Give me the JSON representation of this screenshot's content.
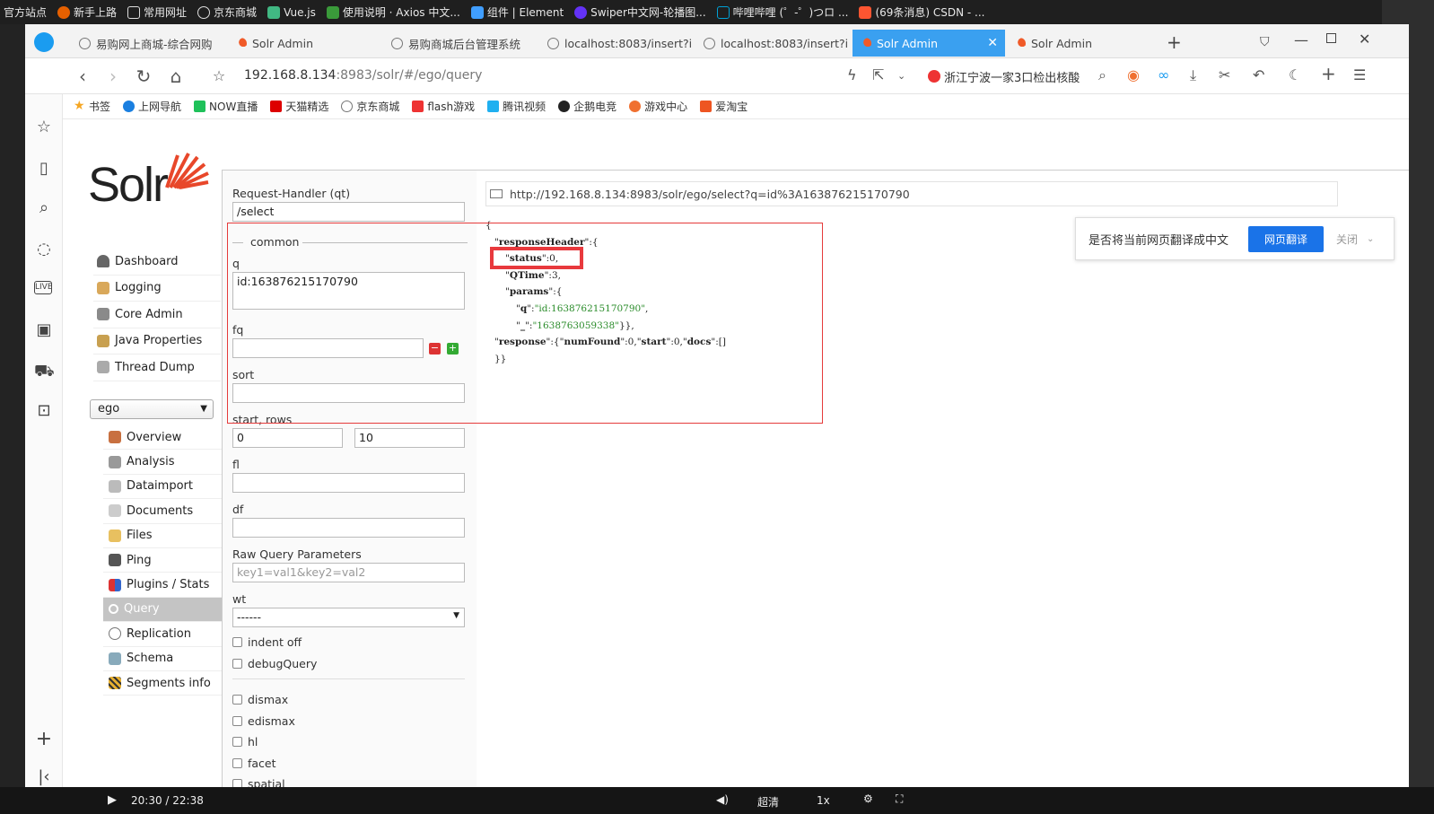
{
  "os_bookmarks": [
    "官方站点",
    "新手上路",
    "常用网址",
    "京东商城",
    "Vue.js",
    "使用说明 · Axios 中文...",
    "组件 | Element",
    "Swiper中文网-轮播图...",
    "哔哩哔哩 (゜-゜)つロ ...",
    "(69条消息) CSDN - ..."
  ],
  "tabs": [
    "易购网上商城-综合网购",
    "Solr Admin",
    "易购商城后台管理系统",
    "localhost:8083/insert?i",
    "localhost:8083/insert?i",
    "Solr Admin",
    "Solr Admin"
  ],
  "address": {
    "url_host": "192.168.8.134",
    "url_rest": ":8983/solr/#/ego/query",
    "search_text": "浙江宁波一家3口检出核酸"
  },
  "bookmarks": [
    "书签",
    "上网导航",
    "NOW直播",
    "天猫精选",
    "京东商城",
    "flash游戏",
    "腾讯视频",
    "企鹅电竞",
    "游戏中心",
    "爱淘宝"
  ],
  "solr": {
    "logo": "Solr",
    "nav": [
      "Dashboard",
      "Logging",
      "Core Admin",
      "Java Properties",
      "Thread Dump"
    ],
    "core": "ego",
    "subnav": [
      "Overview",
      "Analysis",
      "Dataimport",
      "Documents",
      "Files",
      "Ping",
      "Plugins / Stats",
      "Query",
      "Replication",
      "Schema",
      "Segments info"
    ]
  },
  "form": {
    "rh_label": "Request-Handler (qt)",
    "rh_value": "/select",
    "common": "common",
    "q_label": "q",
    "q_value": "id:163876215170790",
    "fq_label": "fq",
    "sort_label": "sort",
    "startrows_label": "start, rows",
    "start_value": "0",
    "rows_value": "10",
    "fl_label": "fl",
    "df_label": "df",
    "raw_label": "Raw Query Parameters",
    "raw_placeholder": "key1=val1&key2=val2",
    "wt_label": "wt",
    "wt_value": "------",
    "checks": [
      "indent off",
      "debugQuery",
      "dismax",
      "edismax",
      "hl",
      "facet",
      "spatial"
    ]
  },
  "result": {
    "url": "http://192.168.8.134:8983/solr/ego/select?q=id%3A163876215170790"
  },
  "translate": {
    "prompt": "是否将当前网页翻译成中文",
    "button": "网页翻译",
    "close": "关闭"
  },
  "video": {
    "time": "20:30 / 22:38",
    "quality": "超清",
    "speed": "1x"
  },
  "colors": {
    "active_tab": "#3aa0f0",
    "highlight": "#e53b3b",
    "translate_btn": "#1a73e8"
  }
}
